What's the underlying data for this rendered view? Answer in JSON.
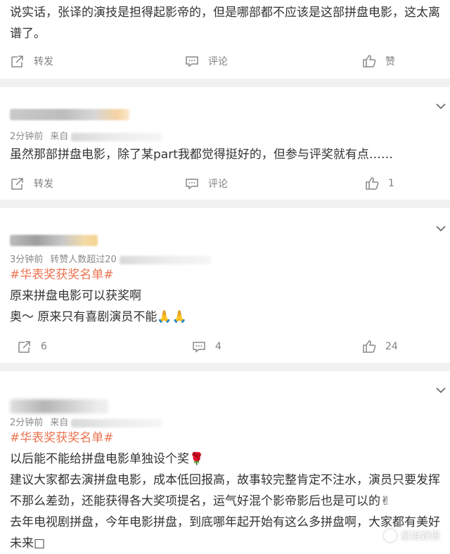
{
  "icons": {
    "repost": "share-icon",
    "comment": "comment-icon",
    "like": "thumbs-up-icon",
    "more": "chevron-down-icon"
  },
  "colors": {
    "topic": "#eb7350",
    "separator": "#f1f1f1",
    "meta": "#8a8a8a"
  },
  "post0": {
    "text": "说实话，张译的演技是担得起影帝的，但是哪部都不应该是这部拼盘电影，这太离谱了。",
    "repost_label": "转发",
    "comment_label": "评论",
    "like_label": "赞"
  },
  "post1": {
    "meta_time": "2分钟前",
    "meta_source": "来自",
    "text": "虽然那部拼盘电影，除了某part我都觉得挺好的，但参与评奖就有点……",
    "repost_label": "转发",
    "comment_label": "评论",
    "like_count": "1"
  },
  "post2": {
    "meta_time": "3分钟前",
    "meta_source": "转赞人数超过20",
    "topic": "#华表奖获奖名单#",
    "line1": "原来拼盘电影可以获奖啊",
    "line2": "奥～ 原来只有喜剧演员不能🙏🙏",
    "repost_count": "6",
    "comment_count": "4",
    "like_count": "24"
  },
  "post3": {
    "meta_time": "2分钟前",
    "meta_source": "来自",
    "topic": "#华表奖获奖名单#",
    "line1": "以后能不能给拼盘电影单独设个奖🌹",
    "line2": "建议大家都去演拼盘电影，成本低回报高，故事较完整肯定不注水，演员只要发挥不那么差劲，还能获得各大奖项提名，运气好混个影帝影后也是可以的✌",
    "line3": "去年电视剧拼盘，今年电影拼盘，到底哪年起开始有这么多拼盘啊，大家都有美好未来□"
  },
  "watermark": "星姐娱报"
}
